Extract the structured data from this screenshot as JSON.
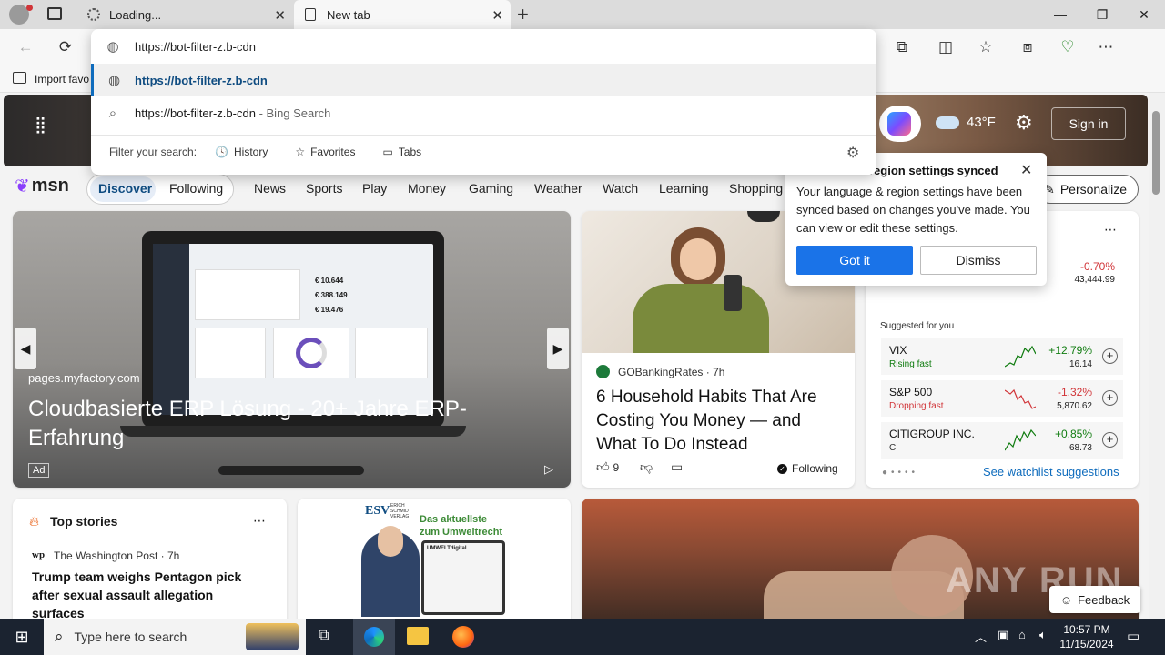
{
  "tabs": [
    {
      "title": "Loading...",
      "active": false
    },
    {
      "title": "New tab",
      "active": true
    }
  ],
  "omnibox": {
    "input_value": "https://bot-filter-z.b-cdn",
    "suggestions": [
      {
        "text": "https://bot-filter-z.b-cdn",
        "suffix": ""
      },
      {
        "text": "https://bot-filter-z.b-cdn",
        "suffix": " - Bing Search"
      }
    ],
    "filter_label": "Filter your search:",
    "filters": [
      "History",
      "Favorites",
      "Tabs"
    ]
  },
  "favorites_bar": {
    "import_label": "Import favo"
  },
  "weather": {
    "temp": "43°F"
  },
  "sign_in": "Sign in",
  "msn": {
    "logo": "msn",
    "nav_tabs": [
      "Discover",
      "Following"
    ],
    "nav_links": [
      "News",
      "Sports",
      "Play",
      "Money",
      "Gaming",
      "Weather",
      "Watch",
      "Learning",
      "Shopping"
    ],
    "personalize": "Personalize"
  },
  "hero": {
    "source": "pages.myfactory.com",
    "headline": "Cloudbasierte ERP Lösung - 20+ Jahre ERP-Erfahrung",
    "ad_label": "Ad",
    "screen_values": [
      "€ 10.644",
      "€ 388.149",
      "€ 19.476"
    ]
  },
  "article": {
    "source": "GOBankingRates",
    "age": "7h",
    "headline": "6 Household Habits That Are Costing You Money — and What To Do Instead",
    "likes": "9",
    "following": "Following"
  },
  "popup": {
    "title": "region settings synced",
    "body": "Your language & region settings have been synced based on changes you've made. You can view or edit these settings.",
    "ok": "Got it",
    "dismiss": "Dismiss"
  },
  "watchlist": {
    "top_pct": "-0.70%",
    "top_price": "43,444.99",
    "suggested_label": "Suggested for you",
    "rows": [
      {
        "name": "VIX",
        "sub": "Rising fast",
        "pct": "+12.79%",
        "price": "16.14",
        "color": "#107c10"
      },
      {
        "name": "S&P 500",
        "sub": "Dropping fast",
        "pct": "-1.32%",
        "price": "5,870.62",
        "color": "#d13438"
      },
      {
        "name": "CITIGROUP INC.",
        "sub": "C",
        "pct": "+0.85%",
        "price": "68.73",
        "color": "#107c10"
      }
    ],
    "see_more": "See watchlist suggestions"
  },
  "top_stories": {
    "title": "Top stories",
    "source": "The Washington Post · 7h",
    "headline": "Trump team weighs Pentagon pick after sexual assault allegation surfaces"
  },
  "ad_card": {
    "brand": "ESV",
    "brand_sub": "ERICH SCHMIDT VERLAG",
    "headline": "Das aktuellste zum Umweltrecht",
    "product": "UMWELTdigital"
  },
  "feedback": "Feedback",
  "watermark": "ANY RUN",
  "taskbar": {
    "search_placeholder": "Type here to search",
    "time": "10:57 PM",
    "date": "11/15/2024"
  }
}
